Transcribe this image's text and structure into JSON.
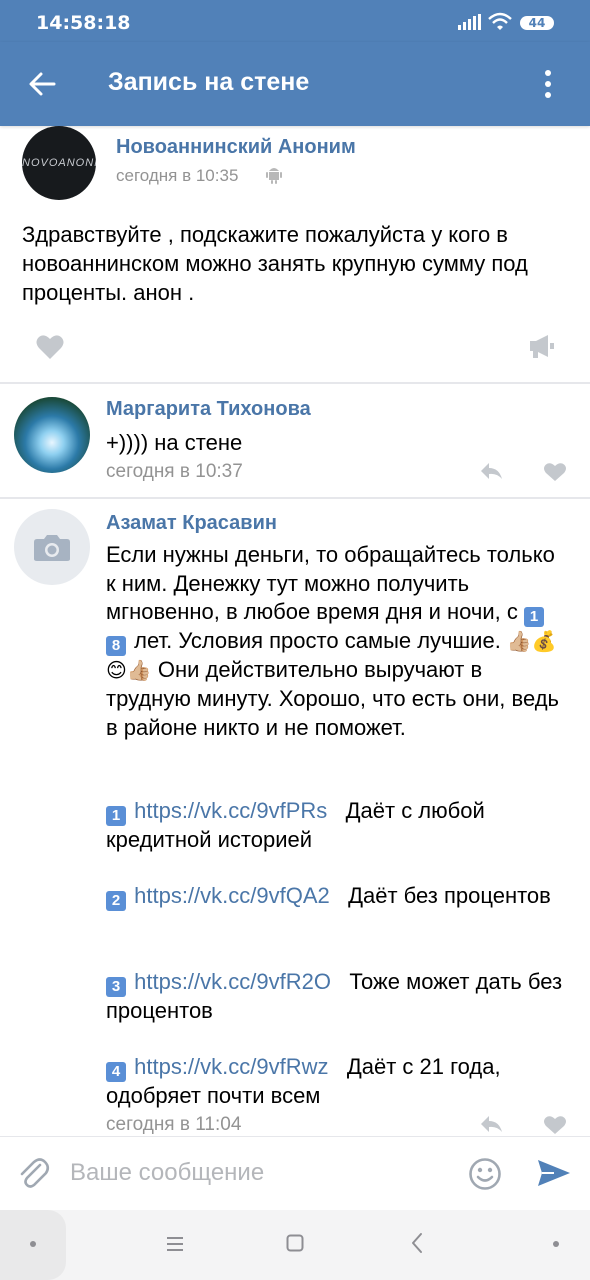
{
  "status_bar": {
    "time": "14:58:18",
    "battery": "44"
  },
  "app_bar": {
    "title": "Запись на стене"
  },
  "post": {
    "author": "Новоаннинский Аноним",
    "avatar_text": "NOVOANONIM",
    "time": "сегодня в 10:35",
    "text": "Здравствуйте , подскажите пожалуйста у кого в новоаннинском можно занять крупную сумму под проценты. анон ."
  },
  "comments": [
    {
      "name": "Маргарита Тихонова",
      "text": "+)))) на стене",
      "time": "сегодня в 10:37"
    },
    {
      "name": "Азамат Красавин",
      "text_intro_1": "Если нужны деньги, то обращайтесь только к ним. Денежку тут можно получить мгновенно, в любое время дня и ночи, с ",
      "age_digits": [
        "1",
        "8"
      ],
      "text_intro_2": " лет. Условия просто самые лучшие. ",
      "emojis": "👍🏼💰😊👍🏼",
      "text_intro_3": " Они действительно выручают в трудную минуту. Хорошо, что есть они, ведь в районе никто и не поможет.",
      "offers": [
        {
          "num": "1",
          "link": "https://vk.cc/9vfPRs",
          "desc": "Даёт с любой кредитной историей"
        },
        {
          "num": "2",
          "link": "https://vk.cc/9vfQA2",
          "desc": "Даёт без процентов"
        },
        {
          "num": "3",
          "link": "https://vk.cc/9vfR2O",
          "desc": "Тоже может дать без процентов"
        },
        {
          "num": "4",
          "link": "https://vk.cc/9vfRwz",
          "desc": "Даёт с 21 года, одобряет почти всем"
        }
      ],
      "time": "сегодня в 11:04"
    }
  ],
  "input": {
    "placeholder": "Ваше сообщение"
  },
  "colors": {
    "header": "#5181b8",
    "link": "#4a76a8",
    "muted": "#939393"
  }
}
